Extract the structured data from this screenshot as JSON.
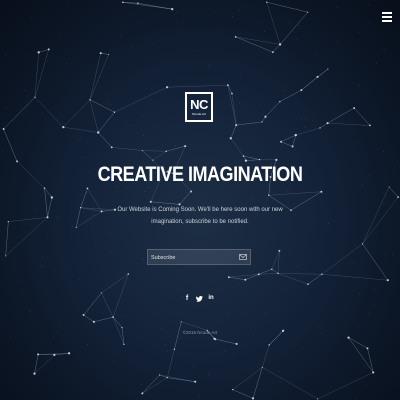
{
  "logo": {
    "mark": "NC",
    "sub": "NCode.Art"
  },
  "headline": "CREATIVE IMAGINATION",
  "tagline": "Our Website is Coming Soon. We'll be here soon with our new imagination, subscribe to be notified.",
  "subscribe": {
    "placeholder": "Subscribe",
    "send_icon": "envelope-icon"
  },
  "social": [
    {
      "icon": "facebook-icon",
      "glyph": "f"
    },
    {
      "icon": "twitter-icon",
      "glyph": "🐦"
    },
    {
      "icon": "linkedin-icon",
      "glyph": "in"
    }
  ],
  "copyright": "©2015 Ncode.Art",
  "colors": {
    "background": "#14233a",
    "lines": "#8fa3b8",
    "text": "#ffffff"
  }
}
